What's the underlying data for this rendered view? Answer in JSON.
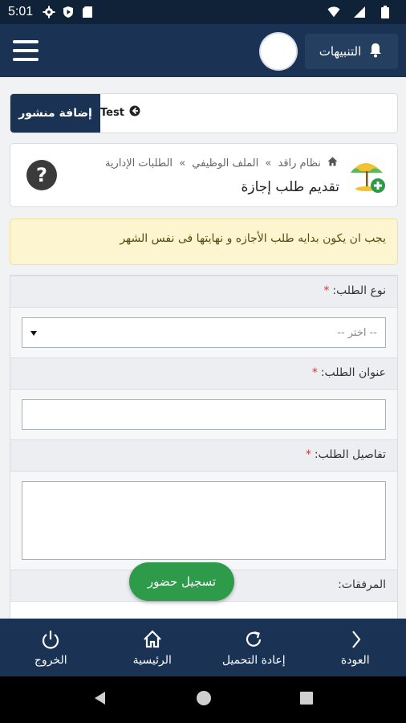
{
  "status_bar": {
    "time": "5:01"
  },
  "header": {
    "notifications_label": "التنبيهات"
  },
  "post_bar": {
    "add_post_label": "إضافة منشور",
    "test_label": "Test"
  },
  "breadcrumb": {
    "items": [
      "نظام راقد",
      "الملف الوظيفي",
      "الطلبات الإدارية"
    ],
    "separator": "»",
    "page_title": "تقديم طلب إجازة"
  },
  "warning": {
    "text": "يجب ان يكون بدايه طلب الأجازه و نهايتها فى نفس الشهر"
  },
  "form": {
    "request_type_label": "نوع الطلب:",
    "request_type_value": "-- اختر --",
    "request_title_label": "عنوان الطلب:",
    "request_details_label": "تفاصيل الطلب:",
    "attachments_label": "المرفقات:",
    "required_mark": "*"
  },
  "fab": {
    "attendance_label": "تسجيل حضور"
  },
  "bottom_nav": {
    "back": "العودة",
    "reload": "إعادة التحميل",
    "home": "الرئيسية",
    "logout": "الخروج"
  },
  "colors": {
    "header_bg": "#1a3354",
    "status_bg": "#102238",
    "fab_green": "#2e9b4a",
    "warning_bg": "#fcf5d0",
    "required_red": "#d9342b"
  }
}
